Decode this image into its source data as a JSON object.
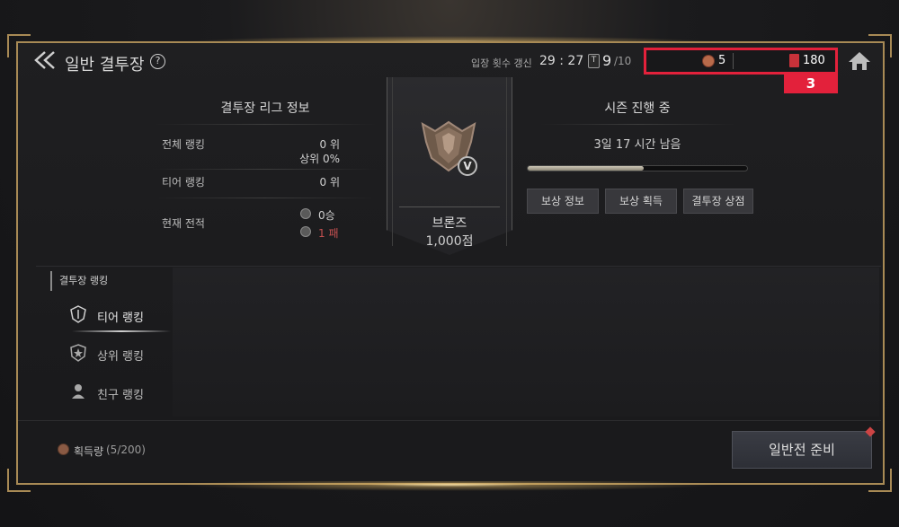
{
  "header": {
    "title": "일반 결투장",
    "help": "?",
    "entry_label": "입장 횟수 갱신",
    "entry_time": "29 : 27",
    "ticket_icon": "T",
    "ticket_current": "9",
    "ticket_max": "/10",
    "currency1_value": "5",
    "currency2_value": "180",
    "badge": "3"
  },
  "league": {
    "title": "결투장 리그 정보",
    "rows": [
      {
        "label": "전체 랭킹",
        "value": "0 위",
        "sub": "상위 0%"
      },
      {
        "label": "티어 랭킹",
        "value": "0 위"
      },
      {
        "label": "현재 전적",
        "wins": "0승",
        "losses": "1 패"
      }
    ]
  },
  "tier": {
    "name": "브론즈",
    "points": "1,000점",
    "rank_badge": "V"
  },
  "season": {
    "title": "시즌 진행 중",
    "remaining": "3일 17 시간 남음",
    "progress": 0.53,
    "buttons": [
      "보상 정보",
      "보상 획득",
      "결투장 상점"
    ]
  },
  "ranking": {
    "header": "결투장 랭킹",
    "items": [
      "티어 랭킹",
      "상위 랭킹",
      "친구 랭킹"
    ],
    "active_index": 0
  },
  "bottom": {
    "gain_label": "획득량",
    "gain_count": "(5/200)",
    "prepare_button": "일반전 준비"
  },
  "colors": {
    "frame": "#a88a55",
    "highlight": "#e3213b",
    "loss": "#c45050"
  }
}
